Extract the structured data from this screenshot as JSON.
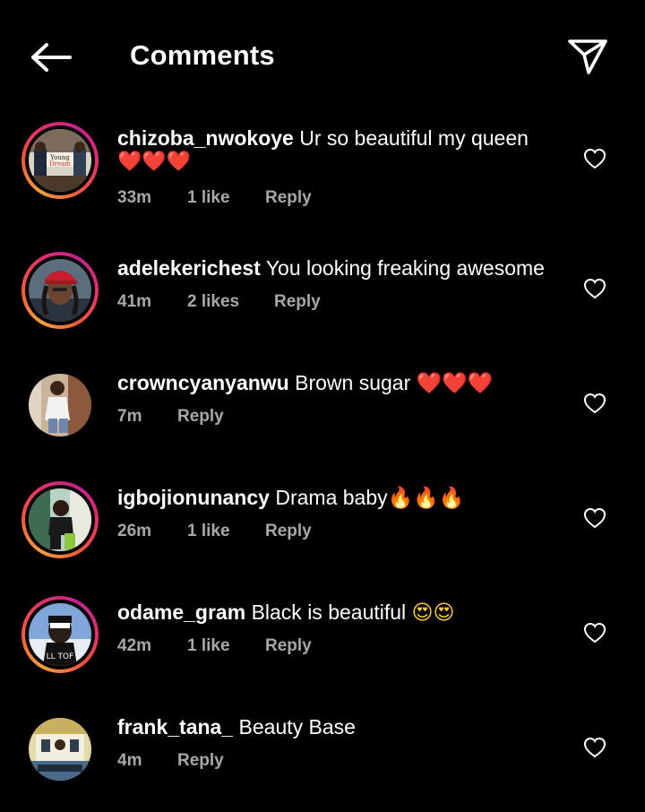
{
  "header": {
    "title": "Comments",
    "back_icon": "arrow-left-icon",
    "share_icon": "paper-plane-icon"
  },
  "comments": [
    {
      "username": "chizoba_nwokoye",
      "text": "Ur so beautiful my queen",
      "emoji": "❤️❤️❤️",
      "time": "33m",
      "likes": "1 like",
      "reply": "Reply",
      "has_story_ring": true
    },
    {
      "username": "adelekerichest",
      "text": "You looking freaking awesome",
      "time": "41m",
      "likes": "2 likes",
      "reply": "Reply",
      "has_story_ring": true
    },
    {
      "username": "crowncyanyanwu",
      "text": "Brown sugar",
      "emoji": "❤️❤️❤️",
      "time": "7m",
      "likes": "",
      "reply": "Reply",
      "has_story_ring": false
    },
    {
      "username": "igbojionunancy",
      "text": "Drama baby",
      "emoji": "🔥🔥🔥",
      "time": "26m",
      "likes": "1 like",
      "reply": "Reply",
      "has_story_ring": true
    },
    {
      "username": "odame_gram",
      "text": "Black is beautiful",
      "emoji": "😍😍",
      "time": "42m",
      "likes": "1 like",
      "reply": "Reply",
      "has_story_ring": true
    },
    {
      "username": "frank_tana_",
      "text": "Beauty Base",
      "time": "4m",
      "likes": "",
      "reply": "Reply",
      "has_story_ring": false
    }
  ],
  "colors": {
    "background": "#000000",
    "text": "#ffffff",
    "meta": "#a8a8a8",
    "ring_start": "#f9a03c",
    "ring_end": "#c4228f"
  }
}
